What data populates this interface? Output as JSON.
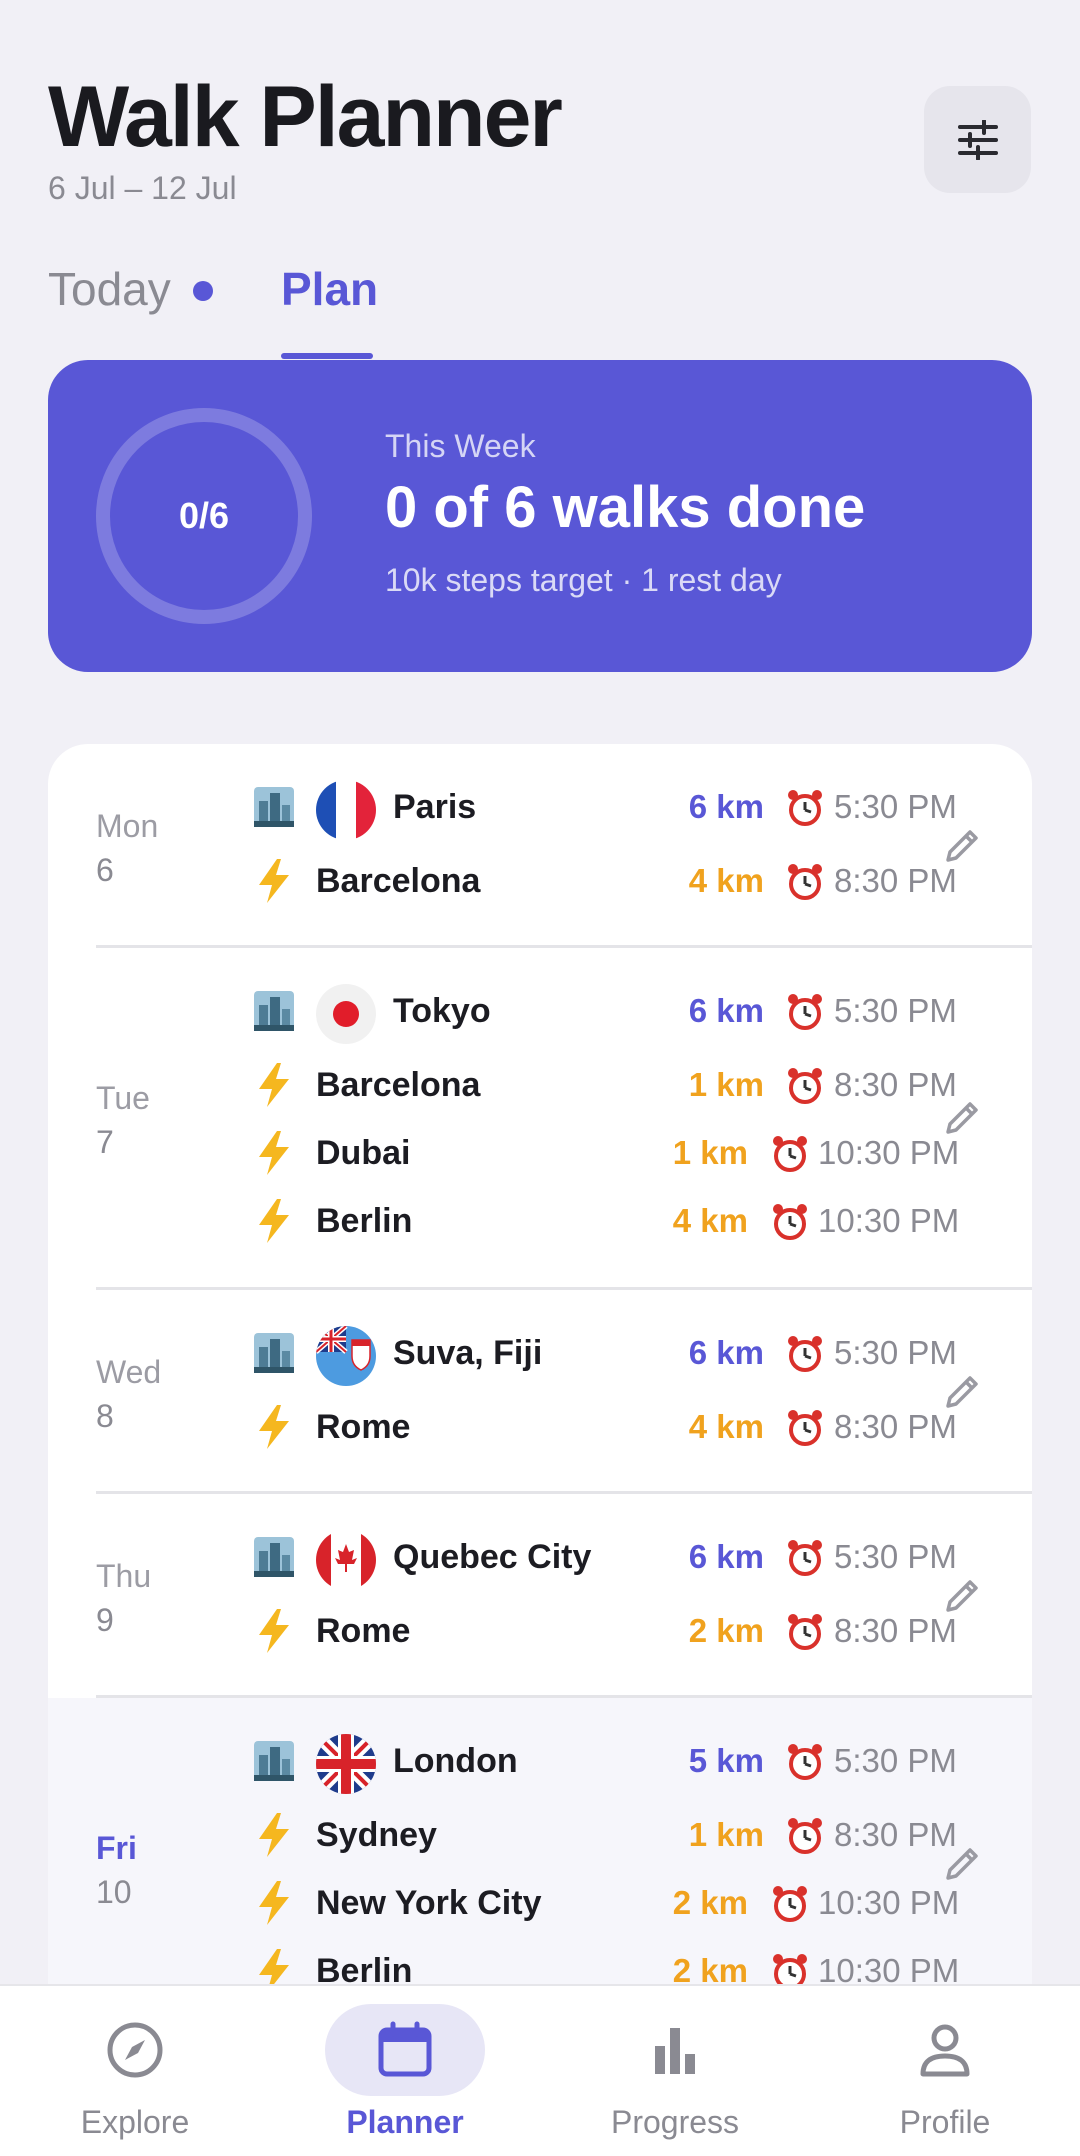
{
  "header": {
    "title": "Walk Planner",
    "date_range": "6 Jul – 12 Jul",
    "filter_icon": "sliders-icon"
  },
  "tabs": [
    {
      "label": "Today",
      "has_dot": true,
      "active": false
    },
    {
      "label": "Plan",
      "active": true
    }
  ],
  "week_summary": {
    "progress": "0/6",
    "label": "This Week",
    "headline": "0 of 6 walks done",
    "meta": "10k steps target · 1 rest day",
    "color": "#5957D6"
  },
  "days": [
    {
      "weekday": "Mon",
      "date": "6",
      "active": false,
      "walks": [
        {
          "kind": "city-icon",
          "flag": "france",
          "city": "Paris",
          "distance": "6 km",
          "type": "primary",
          "time": "5:30 PM"
        },
        {
          "kind": "lightning-icon",
          "city": "Barcelona",
          "distance": "4 km",
          "type": "accent",
          "time": "8:30 PM"
        }
      ]
    },
    {
      "weekday": "Tue",
      "date": "7",
      "active": false,
      "walks": [
        {
          "kind": "city-icon",
          "flag": "japan",
          "city": "Tokyo",
          "distance": "6 km",
          "type": "primary",
          "time": "5:30 PM"
        },
        {
          "kind": "lightning-icon",
          "city": "Barcelona",
          "distance": "1 km",
          "type": "accent",
          "time": "8:30 PM"
        },
        {
          "kind": "lightning-icon",
          "city": "Dubai",
          "distance": "1 km",
          "type": "accent",
          "time": "10:30 PM"
        },
        {
          "kind": "lightning-icon",
          "city": "Berlin",
          "distance": "4 km",
          "type": "accent",
          "time": "10:30 PM"
        }
      ]
    },
    {
      "weekday": "Wed",
      "date": "8",
      "active": false,
      "walks": [
        {
          "kind": "city-icon",
          "flag": "fiji",
          "city": "Suva, Fiji",
          "distance": "6 km",
          "type": "primary",
          "time": "5:30 PM"
        },
        {
          "kind": "lightning-icon",
          "city": "Rome",
          "distance": "4 km",
          "type": "accent",
          "time": "8:30 PM"
        }
      ]
    },
    {
      "weekday": "Thu",
      "date": "9",
      "active": false,
      "walks": [
        {
          "kind": "city-icon",
          "flag": "canada",
          "city": "Quebec City",
          "distance": "6 km",
          "type": "primary",
          "time": "5:30 PM"
        },
        {
          "kind": "lightning-icon",
          "city": "Rome",
          "distance": "2 km",
          "type": "accent",
          "time": "8:30 PM"
        }
      ]
    },
    {
      "weekday": "Fri",
      "date": "10",
      "active": true,
      "walks": [
        {
          "kind": "city-icon",
          "flag": "uk",
          "city": "London",
          "distance": "5 km",
          "type": "primary",
          "time": "5:30 PM"
        },
        {
          "kind": "lightning-icon",
          "city": "Sydney",
          "distance": "1 km",
          "type": "accent",
          "time": "8:30 PM"
        },
        {
          "kind": "lightning-icon",
          "city": "New York City",
          "distance": "2 km",
          "type": "accent",
          "time": "10:30 PM"
        },
        {
          "kind": "lightning-icon",
          "city": "Berlin",
          "distance": "2 km",
          "type": "accent",
          "time": "10:30 PM"
        }
      ]
    }
  ],
  "bottom_nav": [
    {
      "label": "Explore",
      "icon": "compass-icon",
      "active": false
    },
    {
      "label": "Planner",
      "icon": "calendar-icon",
      "active": true
    },
    {
      "label": "Progress",
      "icon": "bar-chart-icon",
      "active": false
    },
    {
      "label": "Profile",
      "icon": "user-icon",
      "active": false
    }
  ],
  "colors": {
    "primary": "#5957D6",
    "accent": "#F0A21E",
    "muted": "#8A8A92",
    "background": "#F1F0F6"
  }
}
